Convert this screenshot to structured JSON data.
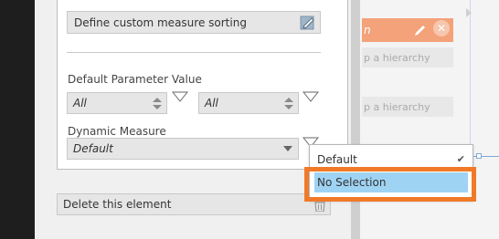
{
  "panel": {
    "custom_sort_label": "Define custom measure sorting",
    "default_param_label": "Default Parameter Value",
    "param_combo_1": "All",
    "param_combo_2": "All",
    "dynamic_measure_label": "Dynamic Measure",
    "dynamic_measure_value": "Default",
    "delete_label": "Delete this element"
  },
  "canvas": {
    "orange_header_text": "n",
    "ghost_1": "p a hierarchy",
    "ghost_2": "p a hierarchy"
  },
  "dropdown": {
    "items": [
      {
        "label": "Default",
        "checked": true
      },
      {
        "label": "No Selection",
        "highlighted": true
      }
    ]
  },
  "colors": {
    "highlight_frame": "#f07a28",
    "selected_item_bg": "#9fd3f4",
    "orange_header": "#f3a27a"
  }
}
